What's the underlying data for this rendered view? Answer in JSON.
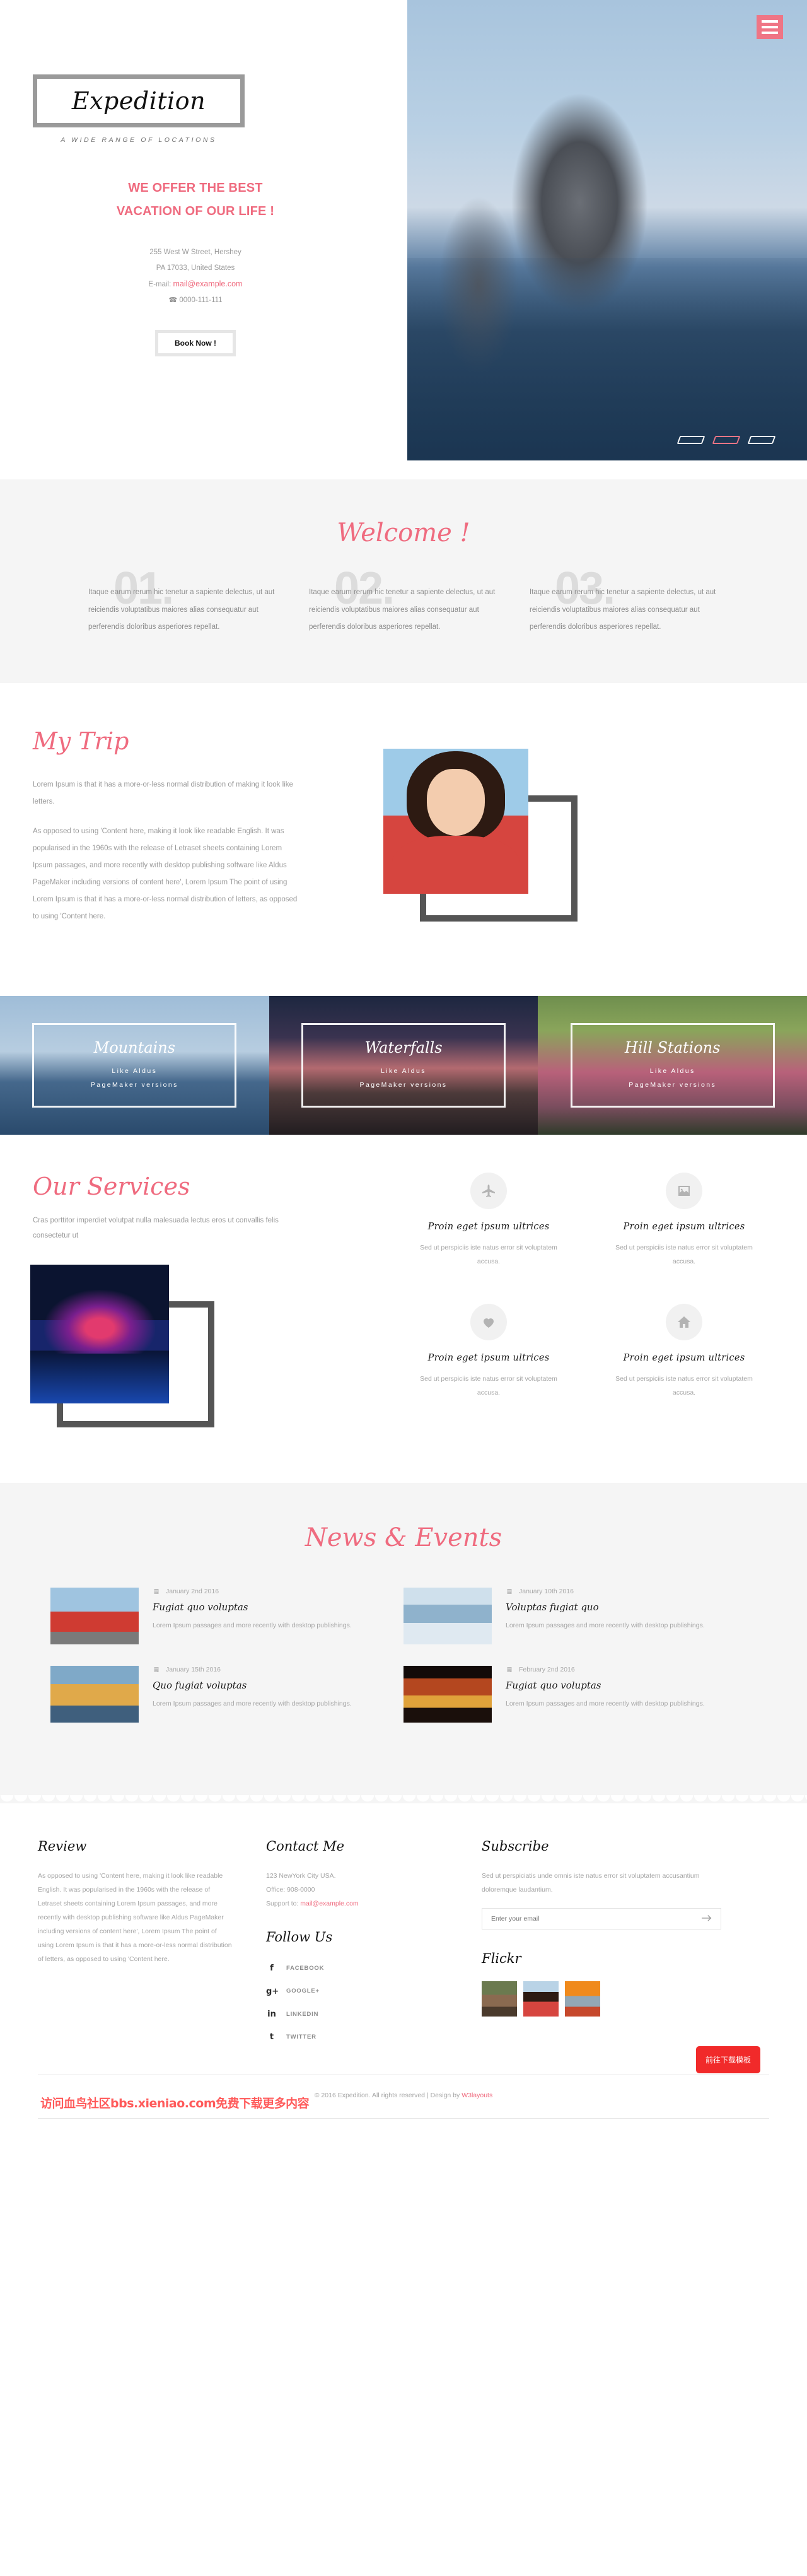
{
  "brand": {
    "logo": "Expedition",
    "tagline": "A WIDE RANGE OF LOCATIONS",
    "accent_color": "#ef6b7f"
  },
  "hero": {
    "menu_icon": "hamburger-menu-icon",
    "headline_line1": "WE OFFER THE BEST",
    "headline_line2": "VACATION OF OUR LIFE !",
    "address_line1": "255 West W Street, Hershey",
    "address_line2": "PA 17033, United States",
    "email_label": "E-mail:",
    "email": "mail@example.com",
    "phone_icon": "phone-icon",
    "phone": "0000-111-111",
    "book_button": "Book Now !",
    "carousel": {
      "slides": 3,
      "active_index": 1
    }
  },
  "welcome": {
    "title": "Welcome !",
    "columns": [
      {
        "number": "01.",
        "text": "Itaque earum rerum hic tenetur a sapiente delectus, ut aut reiciendis voluptatibus maiores alias consequatur aut perferendis doloribus asperiores repellat."
      },
      {
        "number": "02.",
        "text": "Itaque earum rerum hic tenetur a sapiente delectus, ut aut reiciendis voluptatibus maiores alias consequatur aut perferendis doloribus asperiores repellat."
      },
      {
        "number": "03.",
        "text": "Itaque earum rerum hic tenetur a sapiente delectus, ut aut reiciendis voluptatibus maiores alias consequatur aut perferendis doloribus asperiores repellat."
      }
    ]
  },
  "trip": {
    "title": "My Trip",
    "para1": "Lorem Ipsum is that it has a more-or-less normal distribution of making it look like letters.",
    "para2": "As opposed to using 'Content here, making it look like readable English. It was popularised in the 1960s with the release of Letraset sheets containing Lorem Ipsum passages, and more recently with desktop publishing software like Aldus PageMaker including versions of content here', Lorem Ipsum The point of using Lorem Ipsum is that it has a more-or-less normal distribution of letters, as opposed to using 'Content here.",
    "photo_alt": "woman-in-red-jacket-photo"
  },
  "banners": [
    {
      "title": "Mountains",
      "line1": "Like Aldus",
      "line2": "PageMaker versions"
    },
    {
      "title": "Waterfalls",
      "line1": "Like Aldus",
      "line2": "PageMaker versions"
    },
    {
      "title": "Hill Stations",
      "line1": "Like Aldus",
      "line2": "PageMaker versions"
    }
  ],
  "services": {
    "title": "Our Services",
    "intro": "Cras porttitor imperdiet volutpat nulla malesuada lectus eros ut convallis felis consectetur ut",
    "photo_alt": "city-night-lights-photo",
    "items": [
      {
        "icon": "plane-icon",
        "title": "Proin eget ipsum ultrices",
        "text": "Sed ut perspiciis iste natus error sit voluptatem accusa."
      },
      {
        "icon": "image-icon",
        "title": "Proin eget ipsum ultrices",
        "text": "Sed ut perspiciis iste natus error sit voluptatem accusa."
      },
      {
        "icon": "heart-icon",
        "title": "Proin eget ipsum ultrices",
        "text": "Sed ut perspiciis iste natus error sit voluptatem accusa."
      },
      {
        "icon": "home-icon",
        "title": "Proin eget ipsum ultrices",
        "text": "Sed ut perspiciis iste natus error sit voluptatem accusa."
      }
    ]
  },
  "news": {
    "title": "News & Events",
    "items": [
      {
        "date": "January 2nd 2016",
        "title": "Fugiat quo voluptas",
        "text": "Lorem Ipsum passages and more recently with desktop publishings.",
        "thumb": "red-tour-bus-photo"
      },
      {
        "date": "January 10th 2016",
        "title": "Voluptas fugiat quo",
        "text": "Lorem Ipsum passages and more recently with desktop publishings.",
        "thumb": "snowmobiles-photo"
      },
      {
        "date": "January 15th 2016",
        "title": "Quo fugiat voluptas",
        "text": "Lorem Ipsum passages and more recently with desktop publishings.",
        "thumb": "junk-boat-photo"
      },
      {
        "date": "February 2nd 2016",
        "title": "Fugiat quo voluptas",
        "text": "Lorem Ipsum passages and more recently with desktop publishings.",
        "thumb": "festival-lights-photo"
      }
    ]
  },
  "footer": {
    "review": {
      "title": "Review",
      "text": "As opposed to using 'Content here, making it look like readable English. It was popularised in the 1960s with the release of Letraset sheets containing Lorem Ipsum passages, and more recently with desktop publishing software like Aldus PageMaker including versions of content here', Lorem Ipsum The point of using Lorem Ipsum is that it has a more-or-less normal distribution of letters, as opposed to using 'Content here."
    },
    "contact": {
      "title": "Contact Me",
      "address": "123 NewYork City USA.",
      "office": "Office: 908-0000",
      "support_label": "Support to:",
      "support_email": "mail@example.com"
    },
    "follow": {
      "title": "Follow Us",
      "items": [
        {
          "icon": "facebook-icon",
          "glyph": "f",
          "label": "FACEBOOK"
        },
        {
          "icon": "google-plus-icon",
          "glyph": "g+",
          "label": "GOOGLE+"
        },
        {
          "icon": "linkedin-icon",
          "glyph": "in",
          "label": "LINKEDIN"
        },
        {
          "icon": "twitter-icon",
          "glyph": "t",
          "label": "TWITTER"
        }
      ]
    },
    "subscribe": {
      "title": "Subscribe",
      "text": "Sed ut perspiciatis unde omnis iste natus error sit voluptatem accusantium doloremque laudantium.",
      "placeholder": "Enter your email",
      "value": "",
      "submit_icon": "arrow-right-icon"
    },
    "flickr": {
      "title": "Flickr",
      "photos": [
        "man-sunglasses-photo",
        "woman-red-jacket-photo",
        "man-tank-top-photo"
      ]
    },
    "copyright_pre": "© 2016 Expedition. All rights reserved | Design by ",
    "copyright_link": "W3layouts",
    "watermark": "访问血鸟社区bbs.xieniao.com免费下载更多内容",
    "download_button": "前往下载模板"
  }
}
